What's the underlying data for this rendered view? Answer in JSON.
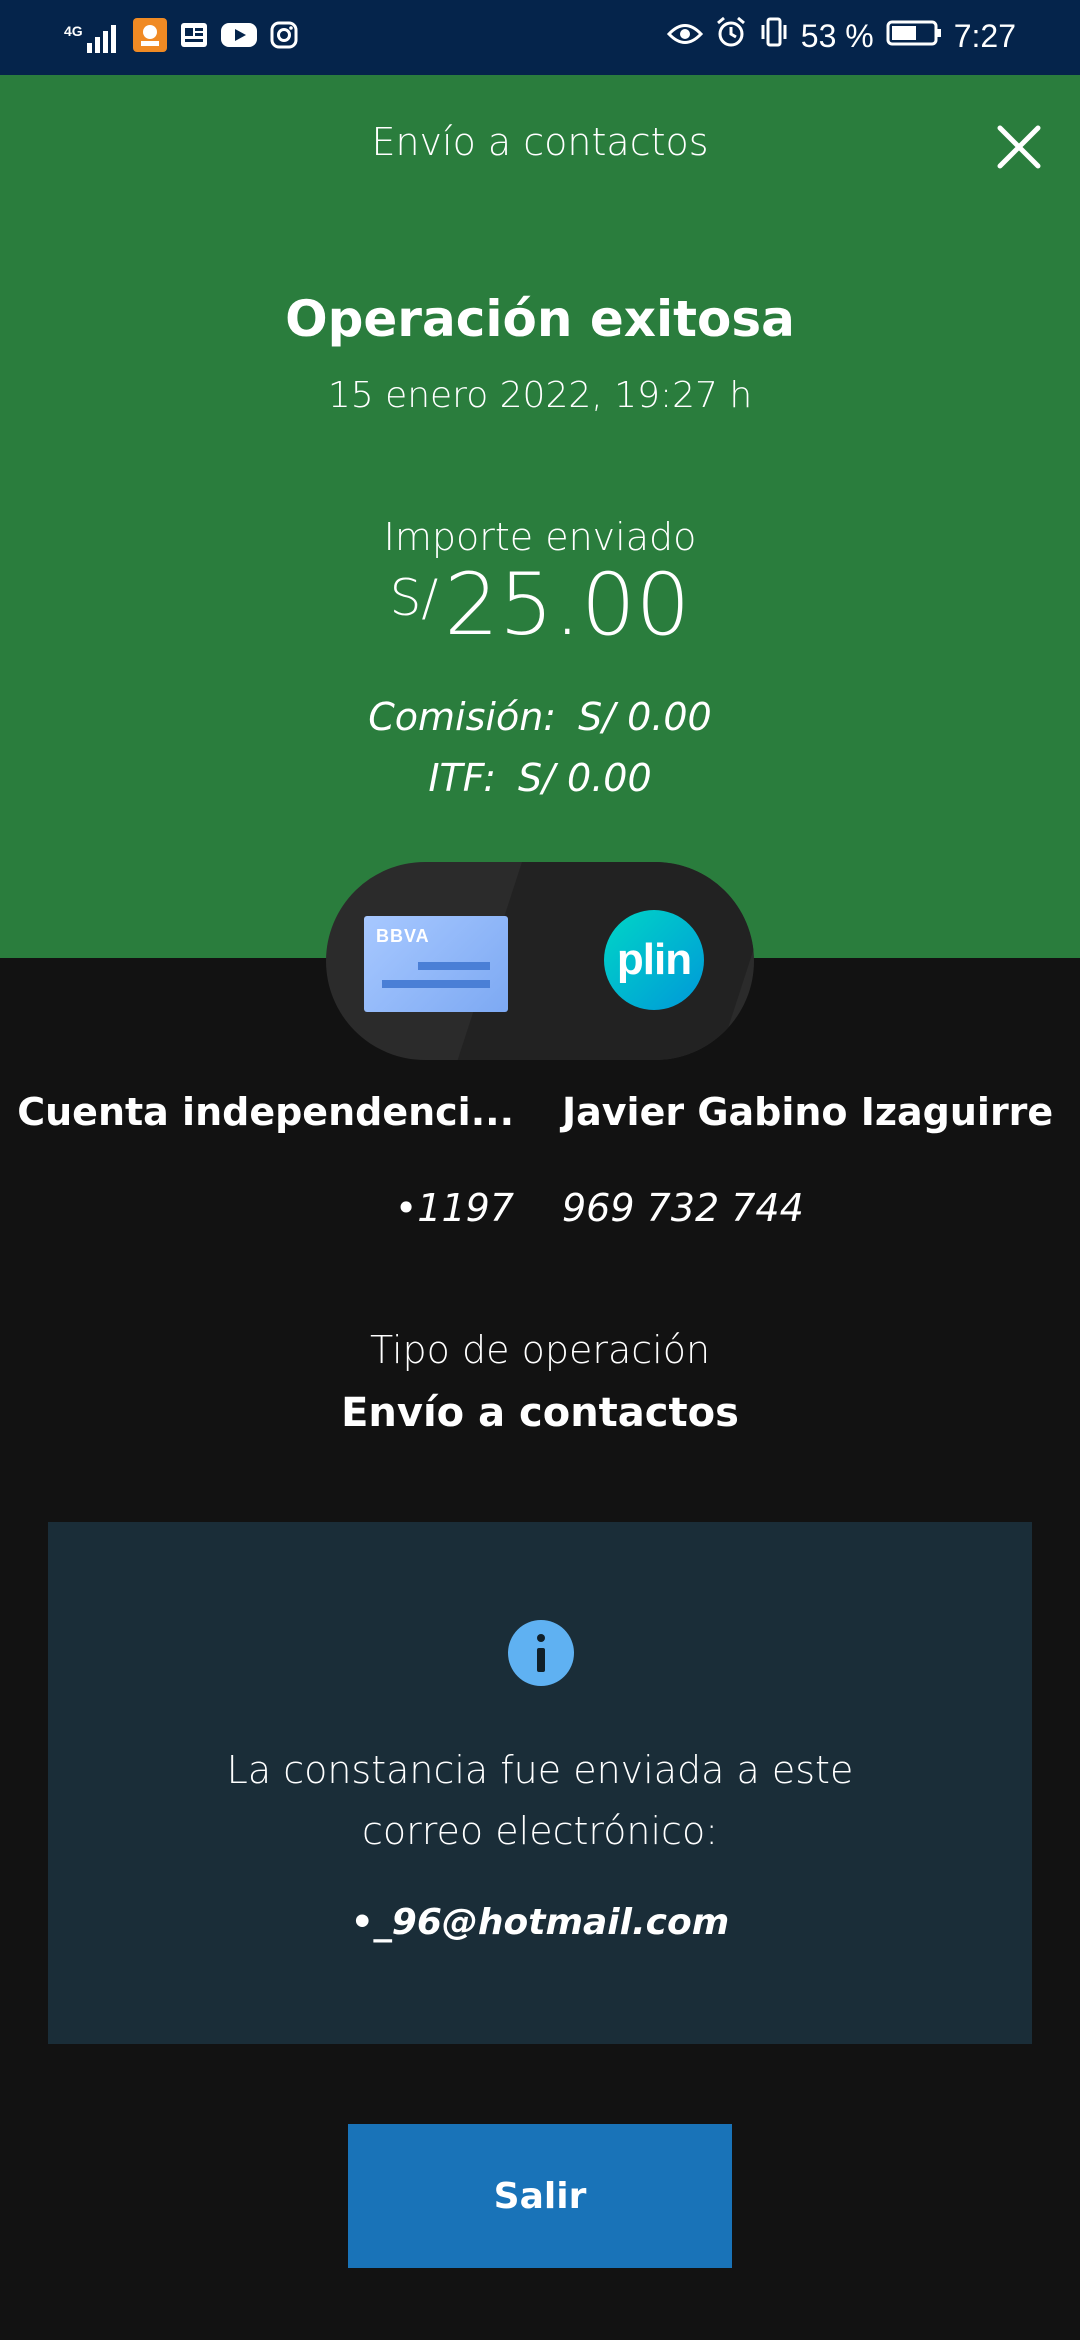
{
  "status_bar": {
    "network": "4G",
    "battery_percent": "53 %",
    "time": "7:27",
    "left_icons": [
      "signal-icon",
      "app-notification-icon",
      "news-icon",
      "youtube-icon",
      "instagram-icon"
    ],
    "right_icons": [
      "eye-icon",
      "alarm-icon",
      "vibrate-icon",
      "battery-icon"
    ]
  },
  "header": {
    "title": "Envío a contactos",
    "close_icon": "close-icon"
  },
  "operation": {
    "title": "Operación exitosa",
    "date": "15 enero 2022, 19:27 h",
    "amount_label": "Importe enviado",
    "currency": "S/",
    "amount": "25.00",
    "commission_label": "Comisión:",
    "commission_value": "S/ 0.00",
    "itf_label": "ITF:",
    "itf_value": "S/ 0.00"
  },
  "source": {
    "card_brand": "BBVA",
    "name": "Cuenta independenci...",
    "number": "•1197"
  },
  "destination": {
    "app_logo": "plin",
    "name": "Javier Gabino Izaguirre",
    "number": "969 732 744"
  },
  "operation_type": {
    "label": "Tipo de operación",
    "value": "Envío a contactos"
  },
  "info": {
    "icon": "info-icon",
    "message": "La constancia fue enviada a este correo electrónico:",
    "email": "•_96@hotmail.com"
  },
  "actions": {
    "exit_label": "Salir"
  },
  "colors": {
    "status_bar": "#05244b",
    "header_green": "#2a7d3d",
    "background": "#121212",
    "info_box": "#1a2d38",
    "button_blue": "#1973b8"
  }
}
